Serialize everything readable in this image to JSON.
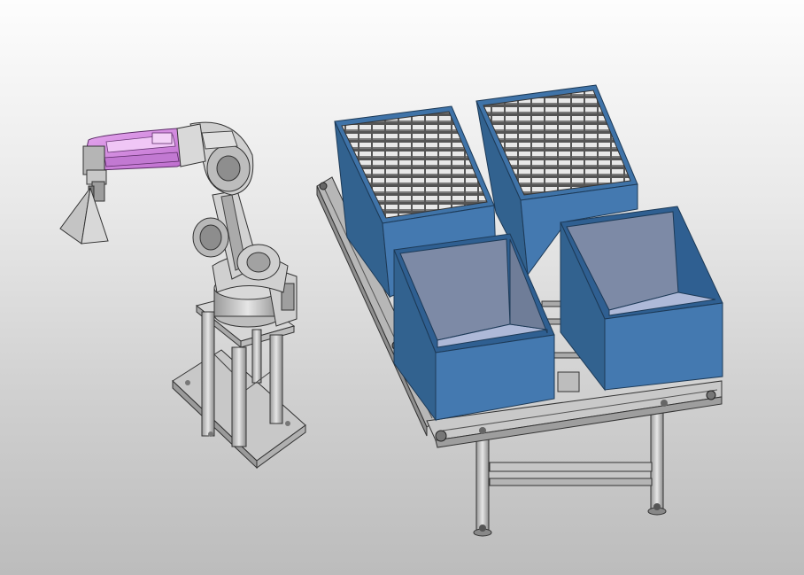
{
  "viewport": {
    "background_top": "#fdfdfd",
    "background_bottom": "#bcbcbc"
  },
  "scene": {
    "robot": {
      "arm_highlight_color": "#d98fe6",
      "body_color": "#cfcfcf",
      "edge_color": "#3a3a3a"
    },
    "bins": {
      "bin_color": "#3f73a8",
      "bin_inner_color": "#2f5f91",
      "bin_floor_color": "#aeb9d8",
      "count": 4,
      "filled_bins": 2,
      "empty_bins": 2
    },
    "conveyor": {
      "frame_color": "#bdbdbd"
    }
  }
}
